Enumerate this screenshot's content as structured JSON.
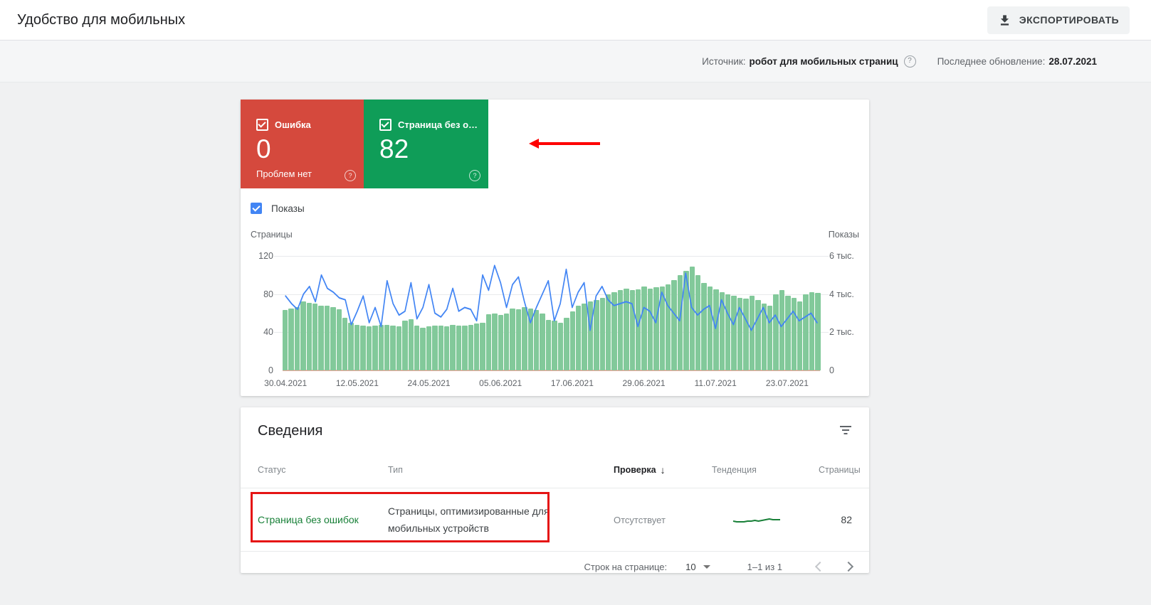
{
  "header": {
    "title": "Удобство для мобильных",
    "export_label": "ЭКСПОРТИРОВАТЬ"
  },
  "meta": {
    "source_label": "Источник:",
    "source_value": "робот для мобильных страниц",
    "updated_label": "Последнее обновление:",
    "updated_value": "28.07.2021"
  },
  "summary": {
    "error_card": {
      "label": "Ошибка",
      "value": "0",
      "subtext": "Проблем нет",
      "checked": true,
      "color": "#d5493d"
    },
    "valid_card": {
      "label": "Страница без о…",
      "value": "82",
      "checked": true,
      "color": "#0f9d58"
    }
  },
  "chart": {
    "impressions_label": "Показы",
    "impressions_checkbox_color": "#4285f4"
  },
  "chart_data": {
    "type": "combo-bar-line",
    "x_start": "30.04.2021",
    "x_end": "28.07.2021",
    "n_points": 90,
    "x_ticks": [
      {
        "label": "30.04.2021",
        "index": 0
      },
      {
        "label": "12.05.2021",
        "index": 12
      },
      {
        "label": "24.05.2021",
        "index": 24
      },
      {
        "label": "05.06.2021",
        "index": 36
      },
      {
        "label": "17.06.2021",
        "index": 48
      },
      {
        "label": "29.06.2021",
        "index": 60
      },
      {
        "label": "11.07.2021",
        "index": 72
      },
      {
        "label": "23.07.2021",
        "index": 84
      }
    ],
    "left_axis": {
      "title": "Страницы",
      "min": 0,
      "max": 120,
      "ticks": [
        0,
        40,
        80,
        120
      ],
      "tick_labels_desc": [
        "120",
        "80",
        "40",
        "0"
      ]
    },
    "right_axis": {
      "title": "Показы",
      "min": 0,
      "max": 6,
      "ticks_thousands": [
        0,
        2,
        4,
        6
      ],
      "tick_labels_desc": [
        "6 тыс.",
        "4 тыс.",
        "2 тыс.",
        "0"
      ]
    },
    "grid": true,
    "baseline_color": "#f2a89f",
    "series": [
      {
        "name": "Страницы",
        "render": "bar",
        "axis": "left",
        "color": "#82c99a",
        "values": [
          63,
          65,
          66,
          72,
          71,
          70,
          68,
          68,
          66,
          64,
          55,
          50,
          48,
          47,
          46,
          47,
          48,
          48,
          47,
          46,
          52,
          54,
          47,
          45,
          46,
          47,
          47,
          46,
          48,
          47,
          47,
          48,
          49,
          50,
          59,
          60,
          58,
          60,
          65,
          64,
          66,
          65,
          63,
          60,
          53,
          52,
          50,
          55,
          62,
          68,
          70,
          72,
          74,
          76,
          80,
          82,
          84,
          86,
          84,
          85,
          88,
          86,
          87,
          88,
          90,
          95,
          100,
          104,
          109,
          100,
          92,
          88,
          85,
          82,
          80,
          78,
          76,
          75,
          78,
          74,
          70,
          68,
          80,
          84,
          78,
          76,
          72,
          80,
          82,
          81
        ]
      },
      {
        "name": "Показы (тыс.)",
        "render": "line",
        "axis": "right",
        "color": "#4285f4",
        "values": [
          3.9,
          3.5,
          3.2,
          4.0,
          4.4,
          3.6,
          5.0,
          4.3,
          4.1,
          3.8,
          3.7,
          2.4,
          3.1,
          3.9,
          2.5,
          3.3,
          2.3,
          4.7,
          3.5,
          2.9,
          3.1,
          4.6,
          2.7,
          3.3,
          4.5,
          3.0,
          2.8,
          3.2,
          4.3,
          3.1,
          3.3,
          3.2,
          2.6,
          5.0,
          4.2,
          5.5,
          4.6,
          3.3,
          4.5,
          4.9,
          3.6,
          2.5,
          3.3,
          4.0,
          4.7,
          2.6,
          3.5,
          5.3,
          3.3,
          4.1,
          4.6,
          2.1,
          3.9,
          4.4,
          3.7,
          3.4,
          3.5,
          3.6,
          3.5,
          2.3,
          3.3,
          3.1,
          2.5,
          4.1,
          3.4,
          3.0,
          2.6,
          5.1,
          3.3,
          2.9,
          3.2,
          3.4,
          2.2,
          3.7,
          3.0,
          2.4,
          3.3,
          2.7,
          2.1,
          2.7,
          3.3,
          2.5,
          2.9,
          2.3,
          2.7,
          3.1,
          2.6,
          2.8,
          3.0,
          2.5
        ]
      }
    ]
  },
  "details": {
    "title": "Сведения",
    "columns": [
      "Статус",
      "Тип",
      "Проверка",
      "Тенденция",
      "Страницы"
    ],
    "sort_column": "Проверка",
    "sort_direction": "desc",
    "rows": [
      {
        "status": "Страница без ошибок",
        "status_color": "#188038",
        "type": "Страницы, оптимизированные для мобильных устройств",
        "validation": "Отсутствует",
        "trend_color": "#188038",
        "trend": [
          4,
          3,
          3,
          3,
          4,
          4,
          5,
          4,
          5,
          6,
          7,
          6,
          6,
          6
        ],
        "pages": "82"
      }
    ]
  },
  "pagination": {
    "rows_label": "Строк на странице:",
    "rows_value": "10",
    "range": "1–1 из 1"
  },
  "annotations": {
    "arrow_color": "#fe0000",
    "box_color": "#e51414"
  }
}
